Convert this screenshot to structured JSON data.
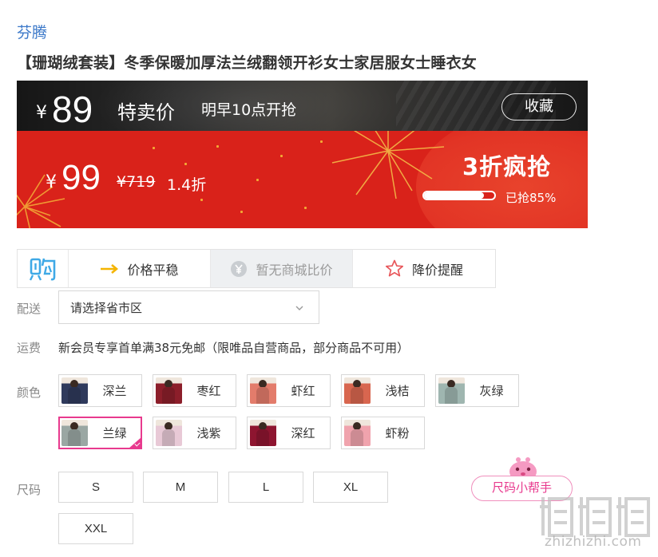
{
  "brand": "芬腾",
  "product_title": "【珊瑚绒套装】冬季保暖加厚法兰绒翻领开衫女士家居服女士睡衣女",
  "flash": {
    "currency": "¥",
    "price": "89",
    "label": "特卖价",
    "start_time": "明早10点开抢",
    "favorite_label": "收藏"
  },
  "sale": {
    "currency": "¥",
    "price": "99",
    "original_price": "¥719",
    "discount": "1.4折",
    "headline": "3折疯抢",
    "sold_percent": 85,
    "sold_text": "已抢85%"
  },
  "infobar": {
    "logo_icon": "gou-logo-icon",
    "price_stable": "价格平稳",
    "no_compare": "暂无商城比价",
    "price_alert": "降价提醒"
  },
  "delivery": {
    "label": "配送",
    "placeholder": "请选择省市区"
  },
  "shipping": {
    "label": "运费",
    "text": "新会员专享首单满38元免邮（限唯品自营商品，部分商品不可用）"
  },
  "colors": {
    "label": "颜色",
    "selected": "兰绿",
    "items": [
      {
        "label": "深兰",
        "tone": "#2f3a5c"
      },
      {
        "label": "枣红",
        "tone": "#8c1e2a"
      },
      {
        "label": "虾红",
        "tone": "#e37c6b"
      },
      {
        "label": "浅桔",
        "tone": "#d8664f"
      },
      {
        "label": "灰绿",
        "tone": "#9fb6b0"
      },
      {
        "label": "兰绿",
        "tone": "#9aa7a3"
      },
      {
        "label": "浅紫",
        "tone": "#e8c9d6"
      },
      {
        "label": "深红",
        "tone": "#8e1530"
      },
      {
        "label": "虾粉",
        "tone": "#f0a3ad"
      }
    ]
  },
  "sizes": {
    "label": "尺码",
    "items": [
      "S",
      "M",
      "L",
      "XL",
      "XXL"
    ],
    "helper": "尺码小帮手"
  },
  "watermark": {
    "url": "zhizhizhi.com"
  },
  "colors_theme": {
    "accent_red": "#d9221a",
    "brand_blue": "#3b78c9",
    "selected_pink": "#e83a8e"
  }
}
